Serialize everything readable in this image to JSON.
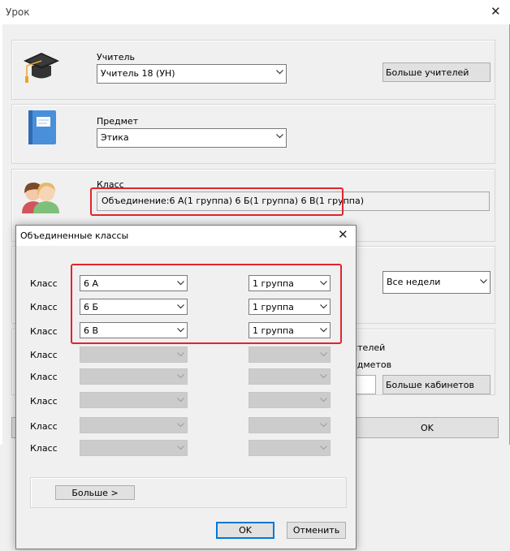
{
  "main_window": {
    "title": "Урок",
    "teacher": {
      "label": "Учитель",
      "value": "Учитель 18 (УН)",
      "more_button": "Больше учителей"
    },
    "subject": {
      "label": "Предмет",
      "value": "Этика"
    },
    "class": {
      "label": "Класс",
      "value": "Объединение:6 А(1 группа) 6 Б(1 группа) 6 В(1 группа)"
    },
    "weeks": {
      "value": "Все недели"
    },
    "teachers_partial": "ителей",
    "subjects_partial": "едметов",
    "more_rooms_button": "Больше кабинетов",
    "ok_button": "OK"
  },
  "dialog": {
    "title": "Объединенные классы",
    "row_label": "Класс",
    "rows": [
      {
        "class": "6 А",
        "group": "1 группа",
        "enabled": true
      },
      {
        "class": "6 Б",
        "group": "1 группа",
        "enabled": true
      },
      {
        "class": "6 В",
        "group": "1 группа",
        "enabled": true
      },
      {
        "class": "",
        "group": "",
        "enabled": false
      },
      {
        "class": "",
        "group": "",
        "enabled": false
      },
      {
        "class": "",
        "group": "",
        "enabled": false
      },
      {
        "class": "",
        "group": "",
        "enabled": false
      },
      {
        "class": "",
        "group": "",
        "enabled": false
      }
    ],
    "more_button": "Больше >",
    "ok_button": "OK",
    "cancel_button": "Отменить"
  },
  "icons": {
    "teacher": "graduation-cap-icon",
    "subject": "book-icon",
    "class": "students-icon",
    "close": "close-icon",
    "dropdown": "chevron-down-icon"
  },
  "colors": {
    "highlight": "#e2242b",
    "accent": "#0078d7"
  }
}
